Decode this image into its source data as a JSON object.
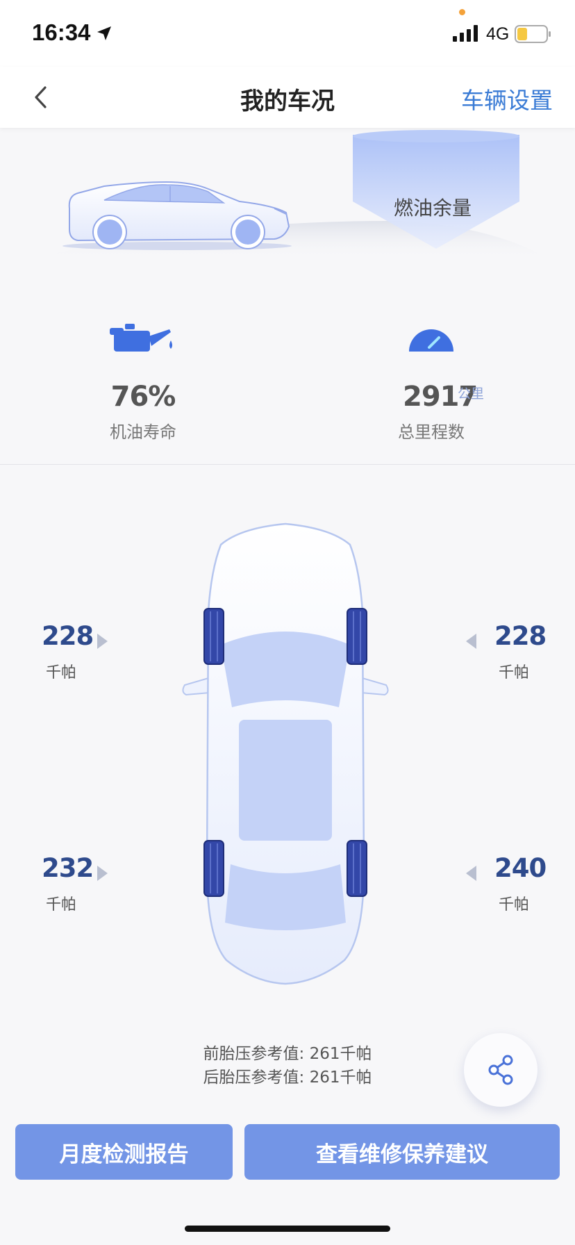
{
  "status_bar": {
    "time": "16:34",
    "network": "4G",
    "icons": [
      "location-arrow-icon",
      "signal-icon",
      "battery-icon"
    ]
  },
  "nav": {
    "title": "我的车况",
    "settings": "车辆设置",
    "back_icon": "chevron-left-icon"
  },
  "fuel": {
    "label": "燃油余量"
  },
  "oil": {
    "value": "76%",
    "label": "机油寿命",
    "icon": "oil-can-icon"
  },
  "mileage": {
    "value": "2917",
    "unit": "公里",
    "label": "总里程数",
    "icon": "speedometer-icon"
  },
  "tires": {
    "front_left": {
      "value": "228",
      "unit": "千帕"
    },
    "front_right": {
      "value": "228",
      "unit": "千帕"
    },
    "rear_left": {
      "value": "232",
      "unit": "千帕"
    },
    "rear_right": {
      "value": "240",
      "unit": "千帕"
    }
  },
  "reference": {
    "front": "前胎压参考值: 261千帕",
    "rear": "后胎压参考值: 261千帕"
  },
  "buttons": {
    "report": "月度检测报告",
    "advice": "查看维修保养建议"
  },
  "colors": {
    "accent": "#3a7bd5",
    "button": "#7395e6",
    "tire_value": "#2e4a8c"
  }
}
